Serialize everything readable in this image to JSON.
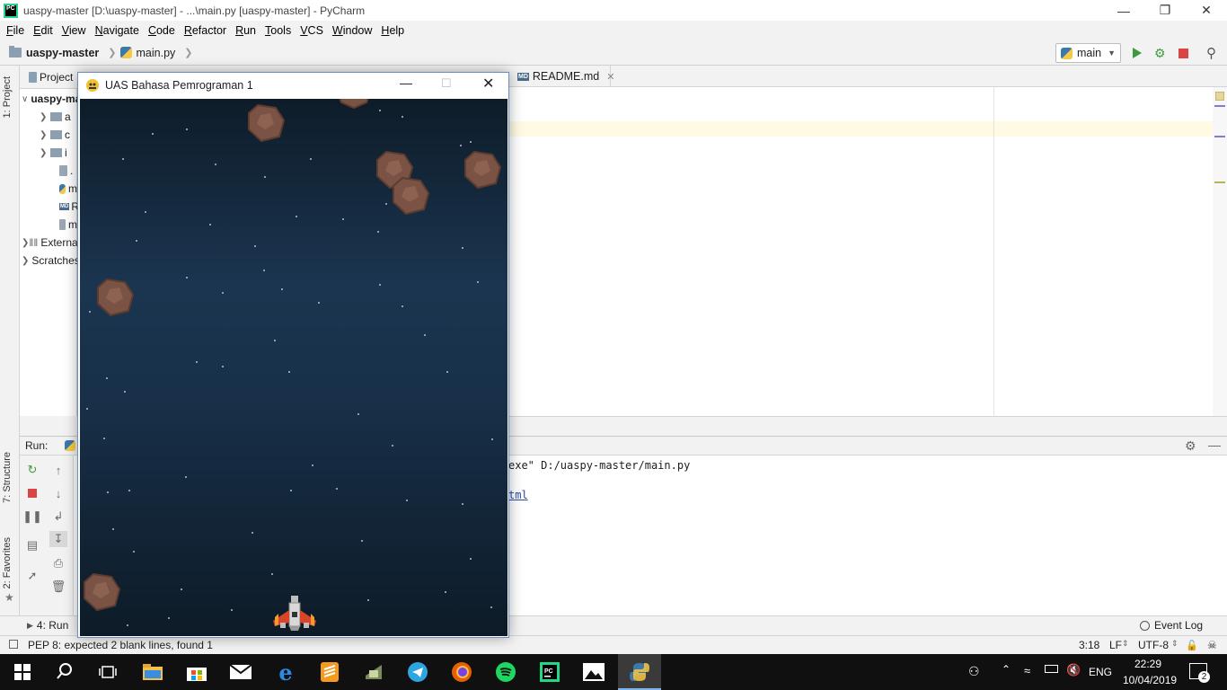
{
  "window": {
    "title": "uaspy-master [D:\\uaspy-master] - ...\\main.py [uaspy-master] - PyCharm",
    "logo": "PC"
  },
  "menu": [
    "File",
    "Edit",
    "View",
    "Navigate",
    "Code",
    "Refactor",
    "Run",
    "Tools",
    "VCS",
    "Window",
    "Help"
  ],
  "breadcrumb": {
    "project": "uaspy-master",
    "file": "main.py"
  },
  "run_config": {
    "name": "main"
  },
  "side_tabs": {
    "project": "1: Project",
    "structure": "7: Structure",
    "favorites": "2: Favorites"
  },
  "project_panel": {
    "header": "Project",
    "root": "uaspy-master",
    "rows": [
      "a",
      "c",
      "i",
      ".",
      "m",
      "R",
      "m"
    ],
    "external": "External Libraries",
    "scratches": "Scratches and Consoles"
  },
  "editor_tabs": {
    "readme": "README.md",
    "readme_icon": "MD"
  },
  "run_panel": {
    "label": "Run:",
    "console_line1": "exe\" D:/uaspy-master/main.py",
    "console_line2": "tml"
  },
  "bottom_tools": {
    "run": "4: Run",
    "event_log": "Event Log"
  },
  "status": {
    "message": "PEP 8: expected 2 blank lines, found 1",
    "position": "3:18",
    "line_sep": "LF",
    "encoding": "UTF-8"
  },
  "game": {
    "title": "UAS Bahasa Pemrograman 1",
    "colors": {
      "space_top": "#0e1c29",
      "space_mid": "#1b3550",
      "rock": "#7b5344",
      "ship": "#d9442b"
    }
  },
  "taskbar": {
    "language": "ENG",
    "time": "22:29",
    "date": "10/04/2019",
    "notifications": "2",
    "apps": [
      "file-explorer-icon",
      "store-icon",
      "mail-icon",
      "edge-icon",
      "sublime-icon",
      "app-icon",
      "telegram-icon",
      "firefox-icon",
      "spotify-icon",
      "pycharm-icon",
      "photos-icon",
      "python-icon"
    ]
  }
}
